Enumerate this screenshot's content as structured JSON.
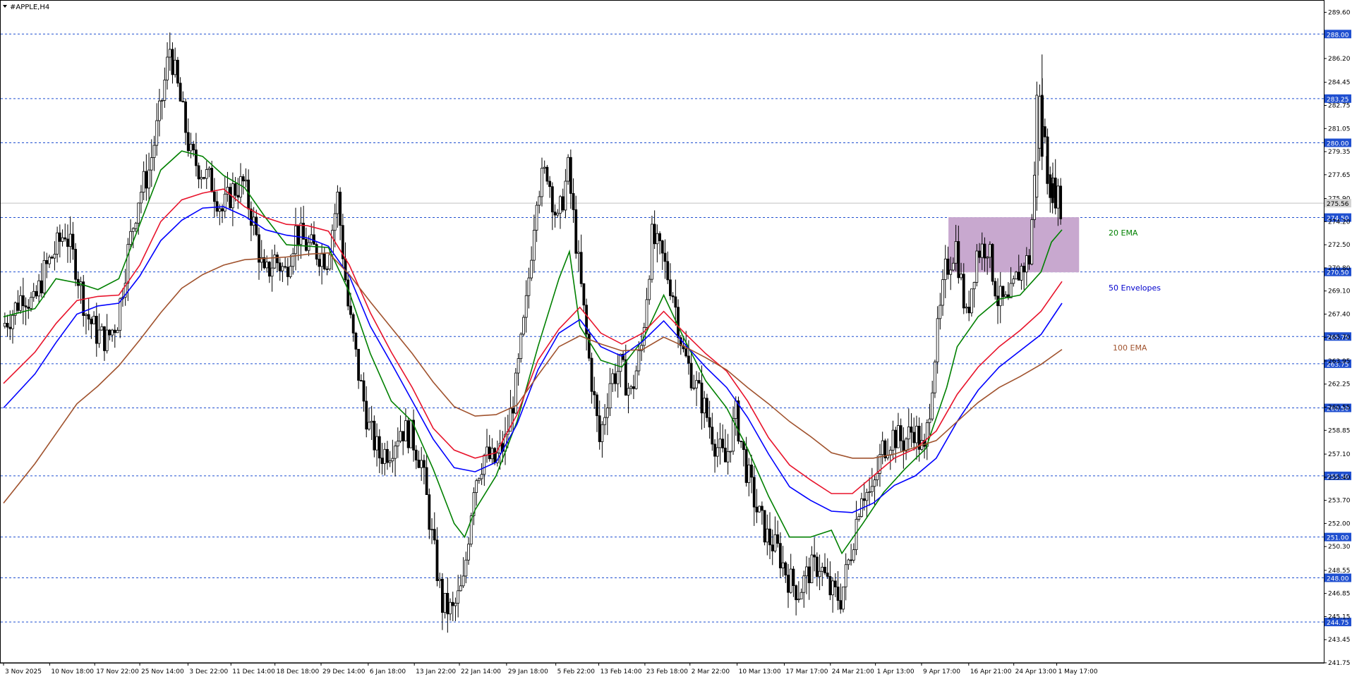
{
  "window": {
    "title": "#APPLE,H4",
    "menu_icon": "triangle-down-icon"
  },
  "colors": {
    "grid_level": "#1f4fd0",
    "candle": "#000000",
    "ema20": "#008000",
    "ema_red": "#e8132b",
    "envelope50": "#0000ff",
    "ema100": "#a0522d",
    "zone_fill": "#c8a8cf",
    "price_label_bg": "#1f4fd0",
    "current_price_bg": "#d3d3d3",
    "axis_text": "#000000",
    "annotation_ema20": "#008000",
    "annotation_env50": "#0000cd",
    "annotation_ema100": "#a0522d"
  },
  "chart_data": {
    "type": "candlestick",
    "symbol": "#APPLE",
    "timeframe": "H4",
    "ylim": [
      241.75,
      290.4
    ],
    "y_ticks": [
      "289.60",
      "286.20",
      "284.45",
      "282.75",
      "281.05",
      "279.35",
      "277.65",
      "275.90",
      "274.20",
      "272.50",
      "270.80",
      "269.10",
      "267.40",
      "265.70",
      "263.95",
      "262.25",
      "260.55",
      "258.85",
      "257.10",
      "255.40",
      "253.70",
      "252.00",
      "250.30",
      "248.55",
      "246.85",
      "245.15",
      "243.45",
      "241.75"
    ],
    "x_ticks": [
      "3 Nov 2025",
      "10 Nov 18:00",
      "17 Nov 22:00",
      "25 Nov 14:00",
      "3 Dec 22:00",
      "11 Dec 14:00",
      "18 Dec 18:00",
      "29 Dec 14:00",
      "6 Jan 18:00",
      "13 Jan 22:00",
      "22 Jan 14:00",
      "29 Jan 18:00",
      "5 Feb 22:00",
      "13 Feb 14:00",
      "23 Feb 18:00",
      "2 Mar 22:00",
      "10 Mar 13:00",
      "17 Mar 17:00",
      "24 Mar 21:00",
      "1 Apr 13:00",
      "9 Apr 17:00",
      "16 Apr 21:00",
      "24 Apr 13:00",
      "1 May 17:00"
    ],
    "x_tick_pos": [
      0,
      4.4,
      8.7,
      13.0,
      17.6,
      21.7,
      25.9,
      30.3,
      34.8,
      39.2,
      43.5,
      48.0,
      52.7,
      56.8,
      61.2,
      65.5,
      70.0,
      74.5,
      78.9,
      83.2,
      87.6,
      92.1,
      96.4,
      100.5
    ],
    "horizontal_levels": [
      "288.00",
      "283.25",
      "280.00",
      "274.50",
      "270.50",
      "265.75",
      "263.75",
      "260.50",
      "255.50",
      "251.00",
      "248.00",
      "244.75"
    ],
    "current_price": "275.56",
    "zone": {
      "x_start": 90.2,
      "x_end": 102.6,
      "y_low": 270.5,
      "y_high": 274.5
    },
    "ohlc_close_path": [
      [
        0,
        266.5
      ],
      [
        1,
        267.5
      ],
      [
        2,
        269.0
      ],
      [
        3,
        268.0
      ],
      [
        4,
        270.5
      ],
      [
        5,
        272.0
      ],
      [
        6,
        273.5
      ],
      [
        7,
        271.0
      ],
      [
        8,
        267.5
      ],
      [
        9,
        266.0
      ],
      [
        10,
        265.5
      ],
      [
        11,
        267.0
      ],
      [
        12,
        272.0
      ],
      [
        13,
        276.0
      ],
      [
        14,
        278.0
      ],
      [
        15,
        282.0
      ],
      [
        16,
        287.0
      ],
      [
        17,
        283.0
      ],
      [
        18,
        279.0
      ],
      [
        19,
        278.0
      ],
      [
        20,
        277.0
      ],
      [
        21,
        275.0
      ],
      [
        22,
        276.5
      ],
      [
        23,
        277.0
      ],
      [
        24,
        274.0
      ],
      [
        25,
        270.0
      ],
      [
        26,
        271.5
      ],
      [
        27,
        270.5
      ],
      [
        28,
        273.5
      ],
      [
        29,
        272.5
      ],
      [
        30,
        272.0
      ],
      [
        31,
        271.5
      ],
      [
        32,
        276.0
      ],
      [
        33,
        268.0
      ],
      [
        34,
        263.0
      ],
      [
        35,
        259.0
      ],
      [
        36,
        257.0
      ],
      [
        37,
        257.5
      ],
      [
        38,
        259.0
      ],
      [
        39,
        258.5
      ],
      [
        40,
        256.5
      ],
      [
        41,
        251.0
      ],
      [
        42,
        246.0
      ],
      [
        43,
        245.5
      ],
      [
        44,
        247.5
      ],
      [
        45,
        255.0
      ],
      [
        46,
        257.0
      ],
      [
        47,
        256.5
      ],
      [
        48,
        258.0
      ],
      [
        49,
        262.0
      ],
      [
        50,
        268.0
      ],
      [
        51,
        276.5
      ],
      [
        52,
        278.0
      ],
      [
        53,
        274.0
      ],
      [
        54,
        278.0
      ],
      [
        55,
        271.0
      ],
      [
        56,
        264.0
      ],
      [
        57,
        258.0
      ],
      [
        58,
        262.5
      ],
      [
        59,
        263.5
      ],
      [
        60,
        261.5
      ],
      [
        61,
        265.0
      ],
      [
        62,
        273.0
      ],
      [
        63,
        271.5
      ],
      [
        64,
        269.0
      ],
      [
        65,
        264.5
      ],
      [
        66,
        262.5
      ],
      [
        67,
        260.5
      ],
      [
        68,
        258.0
      ],
      [
        69,
        256.5
      ],
      [
        70,
        260.0
      ],
      [
        71,
        256.0
      ],
      [
        72,
        253.0
      ],
      [
        73,
        251.0
      ],
      [
        74,
        250.0
      ],
      [
        75,
        248.0
      ],
      [
        76,
        247.0
      ],
      [
        77,
        248.5
      ],
      [
        78,
        249.0
      ],
      [
        79,
        247.0
      ],
      [
        80,
        246.5
      ],
      [
        81,
        250.0
      ],
      [
        82,
        254.5
      ],
      [
        83,
        254.0
      ],
      [
        84,
        257.5
      ],
      [
        85,
        258.5
      ],
      [
        86,
        258.0
      ],
      [
        87,
        259.0
      ],
      [
        88,
        257.0
      ],
      [
        89,
        264.5
      ],
      [
        90,
        270.5
      ],
      [
        91,
        272.5
      ],
      [
        92,
        267.0
      ],
      [
        93,
        272.0
      ],
      [
        94,
        272.5
      ],
      [
        95,
        268.5
      ],
      [
        96,
        268.0
      ],
      [
        97,
        270.5
      ],
      [
        98,
        271.5
      ],
      [
        99,
        283.0
      ],
      [
        100,
        277.0
      ],
      [
        101,
        275.5
      ]
    ],
    "series": [
      {
        "key": "ema20",
        "points": [
          [
            0,
            267.2
          ],
          [
            3,
            267.8
          ],
          [
            5,
            270.0
          ],
          [
            7,
            269.7
          ],
          [
            9,
            269.2
          ],
          [
            11,
            270.0
          ],
          [
            13,
            274.0
          ],
          [
            15,
            278.0
          ],
          [
            17,
            279.4
          ],
          [
            19,
            279.0
          ],
          [
            21,
            277.6
          ],
          [
            23,
            276.7
          ],
          [
            25,
            274.5
          ],
          [
            27,
            272.5
          ],
          [
            29,
            272.4
          ],
          [
            31,
            272.3
          ],
          [
            33,
            269.0
          ],
          [
            35,
            264.5
          ],
          [
            37,
            261.0
          ],
          [
            39,
            259.5
          ],
          [
            41,
            256.0
          ],
          [
            43,
            252.0
          ],
          [
            44,
            251.0
          ],
          [
            45,
            253.0
          ],
          [
            47,
            255.5
          ],
          [
            49,
            259.5
          ],
          [
            51,
            265.0
          ],
          [
            53,
            270.0
          ],
          [
            54,
            272.0
          ],
          [
            55,
            266.5
          ],
          [
            57,
            264.0
          ],
          [
            59,
            263.5
          ],
          [
            61,
            265.5
          ],
          [
            63,
            268.8
          ],
          [
            65,
            265.5
          ],
          [
            67,
            262.5
          ],
          [
            69,
            260.5
          ],
          [
            71,
            257.5
          ],
          [
            73,
            254.0
          ],
          [
            75,
            251.0
          ],
          [
            77,
            251.0
          ],
          [
            79,
            251.5
          ],
          [
            80,
            249.8
          ],
          [
            82,
            252.0
          ],
          [
            84,
            254.3
          ],
          [
            86,
            256.0
          ],
          [
            88,
            257.5
          ],
          [
            90,
            262.0
          ],
          [
            91,
            265.0
          ],
          [
            93,
            267.2
          ],
          [
            95,
            268.5
          ],
          [
            97,
            268.8
          ],
          [
            99,
            270.5
          ],
          [
            100,
            272.7
          ],
          [
            101,
            273.6
          ]
        ]
      },
      {
        "key": "ema_red",
        "points": [
          [
            0,
            262.3
          ],
          [
            3,
            264.6
          ],
          [
            5,
            266.7
          ],
          [
            7,
            268.4
          ],
          [
            9,
            268.7
          ],
          [
            11,
            268.8
          ],
          [
            13,
            271.0
          ],
          [
            15,
            274.2
          ],
          [
            17,
            275.8
          ],
          [
            19,
            276.3
          ],
          [
            21,
            276.6
          ],
          [
            23,
            275.3
          ],
          [
            25,
            274.5
          ],
          [
            27,
            274.0
          ],
          [
            29,
            273.9
          ],
          [
            31,
            273.5
          ],
          [
            33,
            271.0
          ],
          [
            35,
            267.5
          ],
          [
            37,
            264.6
          ],
          [
            39,
            262.0
          ],
          [
            41,
            259.0
          ],
          [
            43,
            257.4
          ],
          [
            45,
            256.8
          ],
          [
            47,
            257.2
          ],
          [
            49,
            260.0
          ],
          [
            51,
            264.0
          ],
          [
            53,
            266.3
          ],
          [
            55,
            267.9
          ],
          [
            57,
            266.0
          ],
          [
            59,
            265.2
          ],
          [
            61,
            266.0
          ],
          [
            63,
            267.6
          ],
          [
            65,
            266.0
          ],
          [
            67,
            264.5
          ],
          [
            69,
            263.2
          ],
          [
            71,
            261.0
          ],
          [
            73,
            258.3
          ],
          [
            75,
            256.3
          ],
          [
            77,
            255.2
          ],
          [
            79,
            254.2
          ],
          [
            81,
            254.2
          ],
          [
            83,
            255.5
          ],
          [
            85,
            256.8
          ],
          [
            87,
            257.5
          ],
          [
            89,
            258.8
          ],
          [
            91,
            261.5
          ],
          [
            93,
            263.5
          ],
          [
            95,
            265.0
          ],
          [
            97,
            266.2
          ],
          [
            99,
            267.6
          ],
          [
            101,
            269.8
          ]
        ]
      },
      {
        "key": "envelope50",
        "points": [
          [
            0,
            260.5
          ],
          [
            3,
            263.0
          ],
          [
            5,
            265.3
          ],
          [
            7,
            267.4
          ],
          [
            9,
            268.0
          ],
          [
            11,
            268.2
          ],
          [
            13,
            270.2
          ],
          [
            15,
            272.8
          ],
          [
            17,
            274.3
          ],
          [
            19,
            275.2
          ],
          [
            21,
            275.3
          ],
          [
            23,
            274.6
          ],
          [
            25,
            273.6
          ],
          [
            27,
            273.2
          ],
          [
            29,
            273.0
          ],
          [
            31,
            272.4
          ],
          [
            33,
            270.2
          ],
          [
            35,
            266.5
          ],
          [
            37,
            263.8
          ],
          [
            39,
            261.0
          ],
          [
            41,
            258.2
          ],
          [
            43,
            256.1
          ],
          [
            45,
            255.8
          ],
          [
            47,
            256.5
          ],
          [
            49,
            259.3
          ],
          [
            51,
            263.3
          ],
          [
            53,
            266.0
          ],
          [
            55,
            267.0
          ],
          [
            57,
            265.0
          ],
          [
            59,
            264.3
          ],
          [
            61,
            265.4
          ],
          [
            63,
            266.9
          ],
          [
            65,
            265.2
          ],
          [
            67,
            263.5
          ],
          [
            69,
            262.0
          ],
          [
            71,
            259.8
          ],
          [
            73,
            257.1
          ],
          [
            75,
            254.7
          ],
          [
            77,
            253.7
          ],
          [
            79,
            252.9
          ],
          [
            81,
            252.8
          ],
          [
            83,
            253.5
          ],
          [
            85,
            254.8
          ],
          [
            87,
            255.5
          ],
          [
            89,
            256.8
          ],
          [
            91,
            259.5
          ],
          [
            93,
            261.8
          ],
          [
            95,
            263.5
          ],
          [
            97,
            264.7
          ],
          [
            99,
            265.9
          ],
          [
            101,
            268.2
          ]
        ]
      },
      {
        "key": "ema100",
        "points": [
          [
            0,
            253.5
          ],
          [
            3,
            256.4
          ],
          [
            5,
            258.6
          ],
          [
            7,
            260.8
          ],
          [
            9,
            262.1
          ],
          [
            11,
            263.6
          ],
          [
            13,
            265.5
          ],
          [
            15,
            267.5
          ],
          [
            17,
            269.3
          ],
          [
            19,
            270.3
          ],
          [
            21,
            271.0
          ],
          [
            23,
            271.4
          ],
          [
            25,
            271.5
          ],
          [
            27,
            271.6
          ],
          [
            29,
            271.8
          ],
          [
            31,
            271.9
          ],
          [
            33,
            270.3
          ],
          [
            35,
            268.3
          ],
          [
            37,
            266.4
          ],
          [
            39,
            264.5
          ],
          [
            41,
            262.4
          ],
          [
            43,
            260.6
          ],
          [
            45,
            259.9
          ],
          [
            47,
            260.0
          ],
          [
            49,
            260.7
          ],
          [
            51,
            262.9
          ],
          [
            53,
            265.0
          ],
          [
            55,
            265.8
          ],
          [
            57,
            265.2
          ],
          [
            59,
            264.7
          ],
          [
            61,
            264.8
          ],
          [
            63,
            265.7
          ],
          [
            65,
            265.0
          ],
          [
            67,
            264.2
          ],
          [
            69,
            263.3
          ],
          [
            71,
            262.0
          ],
          [
            73,
            260.8
          ],
          [
            75,
            259.5
          ],
          [
            77,
            258.4
          ],
          [
            79,
            257.2
          ],
          [
            81,
            256.8
          ],
          [
            83,
            256.8
          ],
          [
            85,
            257.1
          ],
          [
            87,
            257.6
          ],
          [
            89,
            258.1
          ],
          [
            91,
            259.5
          ],
          [
            93,
            260.9
          ],
          [
            95,
            262.0
          ],
          [
            97,
            262.8
          ],
          [
            99,
            263.7
          ],
          [
            101,
            264.8
          ]
        ]
      }
    ],
    "annotations": {
      "ema20_label": "20 EMA",
      "envelopes50_label": "50 Envelopes",
      "ema100_label": "100 EMA"
    }
  }
}
